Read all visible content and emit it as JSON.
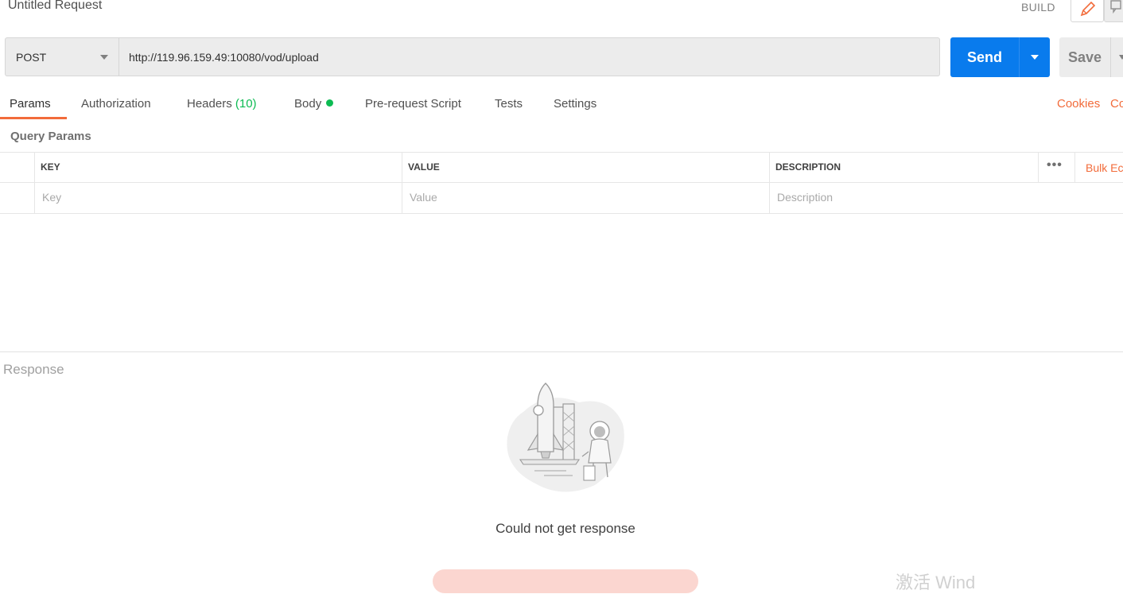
{
  "header": {
    "title": "Untitled Request",
    "build_label": "BUILD"
  },
  "request": {
    "method": "POST",
    "url": "http://119.96.159.49:10080/vod/upload",
    "send_label": "Send",
    "save_label": "Save"
  },
  "tabs": [
    {
      "label": "Params",
      "active": true
    },
    {
      "label": "Authorization"
    },
    {
      "label": "Headers",
      "count": "(10)"
    },
    {
      "label": "Body",
      "indicator_color": "#0cbb52"
    },
    {
      "label": "Pre-request Script"
    },
    {
      "label": "Tests"
    },
    {
      "label": "Settings"
    }
  ],
  "right_links": {
    "cookies": "Cookies",
    "code": "Co"
  },
  "query_params": {
    "title": "Query Params",
    "columns": [
      "KEY",
      "VALUE",
      "DESCRIPTION"
    ],
    "placeholders": {
      "key": "Key",
      "value": "Value",
      "description": "Description"
    },
    "more_label": "•••",
    "bulk_edit": "Bulk Ec"
  },
  "response": {
    "title": "Response",
    "message": "Could not get response"
  },
  "watermark": "激活 Wind",
  "colors": {
    "accent": "#f26b3a",
    "send": "#097bed",
    "success": "#0cbb52"
  }
}
